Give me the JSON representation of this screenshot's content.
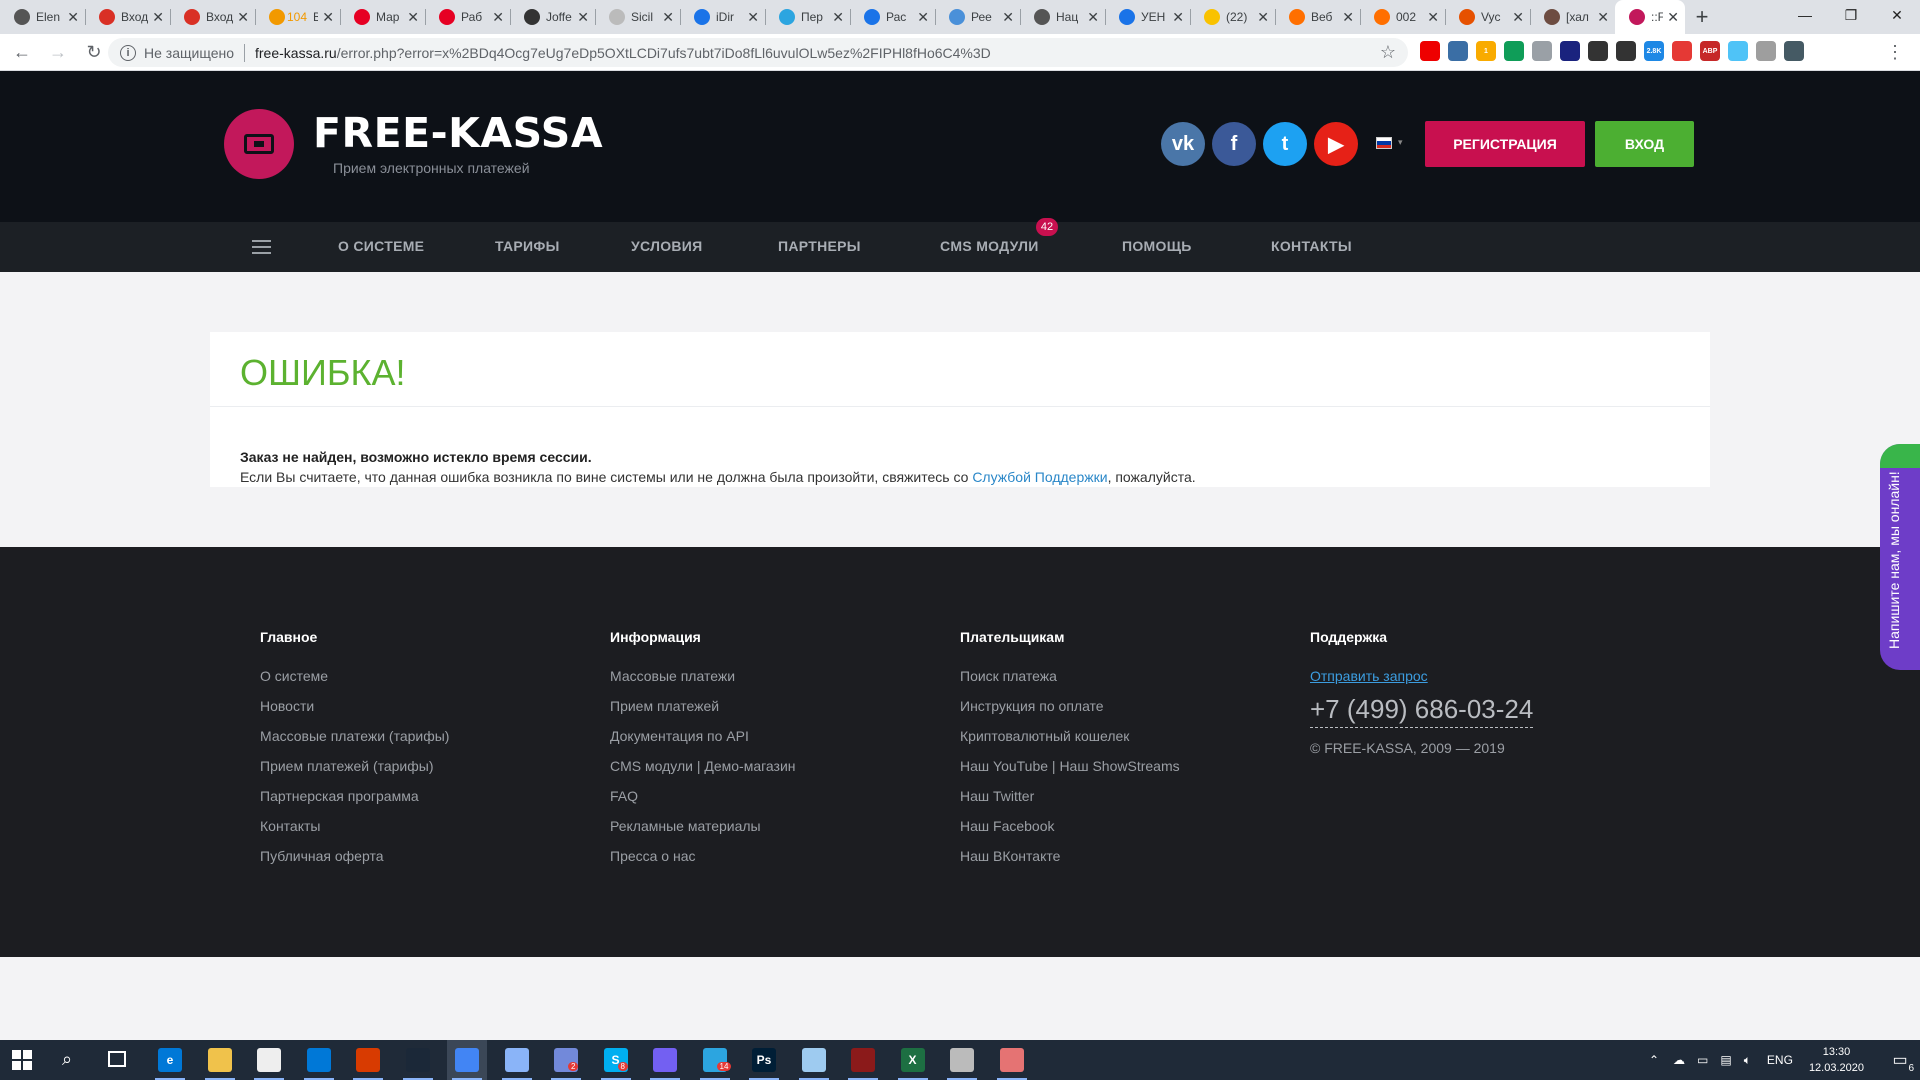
{
  "browser": {
    "tabs": [
      {
        "title": "Elen",
        "color": "#555"
      },
      {
        "title": "Вход",
        "color": "#d93025"
      },
      {
        "title": "Вход",
        "color": "#d93025"
      },
      {
        "title": "Все",
        "color": "#f29900",
        "badge": "104"
      },
      {
        "title": "Мар",
        "color": "#e60023"
      },
      {
        "title": "Раб",
        "color": "#e60023"
      },
      {
        "title": "Joffe",
        "color": "#333"
      },
      {
        "title": "Sicil",
        "color": "#bbb"
      },
      {
        "title": "iDir",
        "color": "#1a73e8"
      },
      {
        "title": "Пер",
        "color": "#2ca5e0"
      },
      {
        "title": "Рас",
        "color": "#1a73e8"
      },
      {
        "title": "Рее",
        "color": "#4a90d9"
      },
      {
        "title": "Нац",
        "color": "#555"
      },
      {
        "title": "УЕН",
        "color": "#1a73e8"
      },
      {
        "title": "(22)",
        "color": "#f9c200"
      },
      {
        "title": "Веб",
        "color": "#ff6f00"
      },
      {
        "title": "002",
        "color": "#ff6f00"
      },
      {
        "title": "Vyc",
        "color": "#e65100"
      },
      {
        "title": "[хал",
        "color": "#6d4c41"
      }
    ],
    "active_tab": {
      "title": "::Fre",
      "color": "#c2185b"
    },
    "new_tab": "+",
    "window_controls": {
      "minimize": "—",
      "maximize": "❐",
      "close": "✕"
    },
    "omnibox": {
      "security_label": "Не защищено",
      "host": "free-kassa.ru",
      "path": "/error.php?error=x%2BDq4Ocg7eUg7eDp5OXtLCDi7ufs7ubt7iDo8fLl6uvulOLw5ez%2FIPHl8fHo6C4%3D"
    },
    "extensions": [
      {
        "name": "opera-icon",
        "color": "#e00"
      },
      {
        "name": "gear-ext-icon",
        "color": "#3a6ea5"
      },
      {
        "name": "keep-icon",
        "color": "#f9ab00",
        "badge": "1"
      },
      {
        "name": "drive-icon",
        "color": "#0f9d58"
      },
      {
        "name": "code-ext-icon",
        "color": "#9aa0a6"
      },
      {
        "name": "play-ext-icon",
        "color": "#1a237e"
      },
      {
        "name": "pen-ext-icon",
        "color": "#333"
      },
      {
        "name": "pipette-ext-icon",
        "color": "#333"
      },
      {
        "name": "counter-ext-icon",
        "color": "#1e88e5",
        "badge": "2.8K"
      },
      {
        "name": "web-ext-icon",
        "color": "#e53935"
      },
      {
        "name": "adblock-icon",
        "color": "#c62828",
        "badge": "ABP"
      },
      {
        "name": "vpn-ext-icon",
        "color": "#4fc3f7"
      },
      {
        "name": "disable-ext-icon",
        "color": "#9e9e9e"
      },
      {
        "name": "profile-avatar-icon",
        "color": "#455a64"
      }
    ]
  },
  "site": {
    "logo_title": "FREE-KASSA",
    "logo_subtitle": "Прием электронных платежей",
    "socials": [
      {
        "name": "vk",
        "glyph": "vk",
        "color": "#4a76a8"
      },
      {
        "name": "facebook",
        "glyph": "f",
        "color": "#3b5998"
      },
      {
        "name": "twitter",
        "glyph": "t",
        "color": "#1da1f2"
      },
      {
        "name": "youtube",
        "glyph": "▶",
        "color": "#e62117"
      }
    ],
    "register_label": "РЕГИСТРАЦИЯ",
    "login_label": "ВХОД",
    "nav": [
      {
        "label": "О СИСТЕМЕ"
      },
      {
        "label": "ТАРИФЫ"
      },
      {
        "label": "УСЛОВИЯ"
      },
      {
        "label": "ПАРТНЕРЫ"
      },
      {
        "label": "CMS МОДУЛИ"
      },
      {
        "label": "ПОМОЩЬ"
      },
      {
        "label": "КОНТАКТЫ"
      }
    ],
    "cms_badge": "42"
  },
  "error": {
    "title": "ОШИБКА!",
    "message": "Заказ не найден, возможно истекло время сессии.",
    "desc_before": "Если Вы считаете, что данная ошибка возникла по вине системы или не должна была произойти, свяжитесь со ",
    "desc_link": "Службой Поддержки",
    "desc_after": ", пожалуйста."
  },
  "footer": {
    "col1": {
      "title": "Главное",
      "links": [
        "О системе",
        "Новости",
        "Массовые платежи (тарифы)",
        "Прием платежей (тарифы)",
        "Партнерская программа",
        "Контакты",
        "Публичная оферта"
      ]
    },
    "col2": {
      "title": "Информация",
      "links": [
        "Массовые платежи",
        "Прием платежей",
        "Документация по API",
        "CMS модули | Демо-магазин",
        "FAQ",
        "Рекламные материалы",
        "Пресса о нас"
      ]
    },
    "col3": {
      "title": "Плательщикам",
      "links": [
        "Поиск платежа",
        "Инструкция по оплате",
        "Криптовалютный кошелек",
        "Наш YouTube | Наш ShowStreams",
        "Наш Twitter",
        "Наш Facebook",
        "Наш ВКонтакте"
      ]
    },
    "col4": {
      "title": "Поддержка",
      "request_link": "Отправить запрос",
      "phone": "+7 (499) 686-03-24",
      "copyright": "© FREE-KASSA, 2009 — 2019"
    }
  },
  "chat_widget": {
    "label": "Напишите нам, мы онлайн!"
  },
  "taskbar": {
    "lang": "ENG",
    "time": "13:30",
    "date": "12.03.2020",
    "notifications": "6",
    "apps": [
      {
        "name": "edge-icon",
        "glyph": "e",
        "color": "#0078d7"
      },
      {
        "name": "explorer-icon",
        "glyph": "",
        "color": "#f0c24b"
      },
      {
        "name": "store-icon",
        "glyph": "",
        "color": "#eee"
      },
      {
        "name": "mail-icon",
        "glyph": "",
        "color": "#0078d7"
      },
      {
        "name": "office-icon",
        "glyph": "",
        "color": "#d83b01"
      },
      {
        "name": "steam-icon",
        "glyph": "",
        "color": "#1b2838"
      },
      {
        "name": "chrome-icon",
        "glyph": "",
        "color": "#4285f4"
      },
      {
        "name": "paint-icon",
        "glyph": "",
        "color": "#8ab4f8"
      },
      {
        "name": "discord-icon",
        "glyph": "",
        "color": "#7289da",
        "badge": "2"
      },
      {
        "name": "skype-icon",
        "glyph": "S",
        "color": "#00aff0",
        "badge": "8"
      },
      {
        "name": "viber-icon",
        "glyph": "",
        "color": "#7360f2"
      },
      {
        "name": "telegram-icon",
        "glyph": "",
        "color": "#2ca5e0",
        "badge": "14"
      },
      {
        "name": "photoshop-icon",
        "glyph": "Ps",
        "color": "#001e36"
      },
      {
        "name": "notepad-icon",
        "glyph": "",
        "color": "#9ecbf0"
      },
      {
        "name": "winrar-icon",
        "glyph": "",
        "color": "#8b1a1a"
      },
      {
        "name": "excel-icon",
        "glyph": "X",
        "color": "#1d6f42"
      },
      {
        "name": "printer-icon",
        "glyph": "",
        "color": "#bbb"
      },
      {
        "name": "app-icon",
        "glyph": "",
        "color": "#e57373"
      }
    ]
  }
}
